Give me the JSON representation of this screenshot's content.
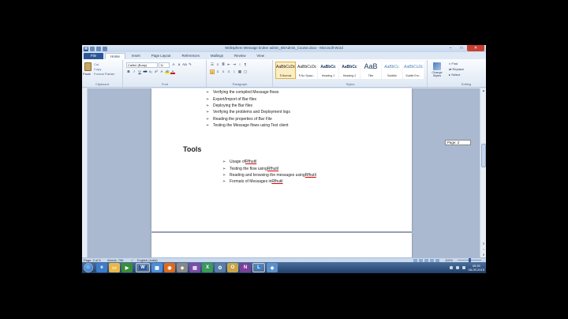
{
  "window": {
    "title": "Websphere Message broker admin_BSAdmin_Course.docx - Microsoft Word"
  },
  "tabs": [
    "File",
    "Home",
    "Insert",
    "Page Layout",
    "References",
    "Mailings",
    "Review",
    "View"
  ],
  "ribbon": {
    "clipboard": {
      "label": "Clipboard",
      "paste": "Paste",
      "cut": "Cut",
      "copy": "Copy",
      "format_painter": "Format Painter"
    },
    "font": {
      "label": "Font",
      "name": "Calibri (Body)",
      "size": "11"
    },
    "paragraph": {
      "label": "Paragraph"
    },
    "styles": {
      "label": "Styles",
      "items": [
        {
          "preview": "AaBbCcDc",
          "name": "¶ Normal"
        },
        {
          "preview": "AaBbCcDc",
          "name": "¶ No Spaci..."
        },
        {
          "preview": "AaBbCc",
          "name": "Heading 1"
        },
        {
          "preview": "AaBbCc",
          "name": "Heading 2"
        },
        {
          "preview": "AaB",
          "name": "Title"
        },
        {
          "preview": "AaBbCc.",
          "name": "Subtitle"
        },
        {
          "preview": "AaBbCcDc",
          "name": "Subtle Em..."
        }
      ],
      "change": "Change Styles"
    },
    "editing": {
      "label": "Editing",
      "find": "Find",
      "replace": "Replace",
      "select": "Select"
    }
  },
  "document": {
    "list1": [
      "Verifying the compiled Message flows",
      "Export/Import of Bar files",
      "Deploying the Bar files",
      "Verifying the problems and Deployment logs",
      "Reading the properties of Bar File",
      "Testing the Message flows using Test client"
    ],
    "heading": "Tools",
    "list2": [
      {
        "text": "Usage of ",
        "term": "Rfhutil"
      },
      {
        "text": "Testing the flow using ",
        "term": "Rfhutil"
      },
      {
        "text": "Reading and browsing the messages using ",
        "term": "Rfhutil"
      },
      {
        "text": "Formats of Messages in ",
        "term": "Rfhutil"
      }
    ]
  },
  "page_tooltip": "Page: 2",
  "status": {
    "page": "Page: 2 of 5",
    "words": "Words: 796",
    "language": "English (India)",
    "zoom": "110%"
  },
  "taskbar": {
    "time": "05:39",
    "date": "08-09-2015"
  }
}
